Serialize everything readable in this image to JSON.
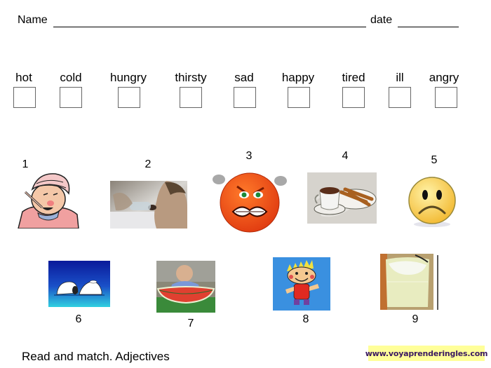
{
  "header": {
    "name_label": "Name",
    "date_label": "date"
  },
  "adjectives": [
    {
      "word": "hot"
    },
    {
      "word": "cold"
    },
    {
      "word": "hungry"
    },
    {
      "word": "thirsty"
    },
    {
      "word": "sad"
    },
    {
      "word": "happy"
    },
    {
      "word": "tired"
    },
    {
      "word": "ill"
    },
    {
      "word": "angry"
    }
  ],
  "pictures": [
    {
      "number": "1",
      "depicts": "sick man with thermometer and head bandage"
    },
    {
      "number": "2",
      "depicts": "man drinking water from bottle"
    },
    {
      "number": "3",
      "depicts": "angry red face emoticon"
    },
    {
      "number": "4",
      "depicts": "hot chocolate with churros"
    },
    {
      "number": "5",
      "depicts": "sad yellow face emoticon"
    },
    {
      "number": "6",
      "depicts": "sleeping dog on blue background"
    },
    {
      "number": "7",
      "depicts": "baby eating watermelon"
    },
    {
      "number": "8",
      "depicts": "happy cartoon child drawing"
    },
    {
      "number": "9",
      "depicts": "glass of cold lemonade"
    }
  ],
  "footer": {
    "instruction": "Read and match. Adjectives",
    "website": "www.voyaprenderingles.com"
  },
  "colors": {
    "website_badge_bg": "#ffff99",
    "website_text": "#3a1860"
  }
}
